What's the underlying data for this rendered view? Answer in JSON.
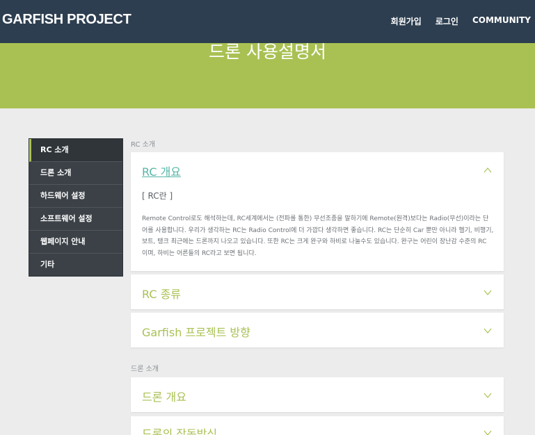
{
  "header": {
    "brand": "GARFISH PROJECT",
    "nav": [
      "회원가입",
      "로그인",
      "COMMUNITY"
    ]
  },
  "banner": {
    "title": "드론 사용설명서"
  },
  "sidebar": {
    "items": [
      {
        "label": "RC 소개",
        "active": true
      },
      {
        "label": "드론 소개"
      },
      {
        "label": "하드웨어 설정"
      },
      {
        "label": "소프트웨어 설정"
      },
      {
        "label": "웹페이지 안내"
      },
      {
        "label": "기타"
      }
    ]
  },
  "sections": [
    {
      "label": "RC 소개",
      "cards": [
        {
          "title": "RC 개요",
          "open": true,
          "subheading": "[ RC란 ]",
          "body": "Remote Control로도 해석하는데, RC세계에서는 (전파를 통한) 무선조종을 말하기에 Remote(원격)보다는 Radio(무선)이라는 단어를 사용합니다. 우리가 생각하는 RC는 Radio Control에 더 가깝다 생각하면 좋습니다. RC는 단순히 Car 뿐만 아니라 헬기, 비행기, 보트, 탱크 최근에는 드론까지 나오고 있습니다. 또한 RC는 크게 완구와 하비로 나눌수도 있습니다. 완구는 어린이 장난감 수준의 RC 이며, 하비는 어른들의 RC라고 보면 됩니다."
        },
        {
          "title": "RC 종류",
          "open": false
        },
        {
          "title": "Garfish 프로젝트 방향",
          "open": false
        }
      ]
    },
    {
      "label": "드론 소개",
      "cards": [
        {
          "title": "드론 개요",
          "open": false
        },
        {
          "title": "드론의 작동방식",
          "open": false
        }
      ]
    }
  ],
  "colors": {
    "header_bg": "#2d3e50",
    "banner_bg": "#a9c153",
    "accent_green": "#a9c153",
    "open_title": "#55b5a6",
    "sidebar_bg": "#3b4147"
  }
}
